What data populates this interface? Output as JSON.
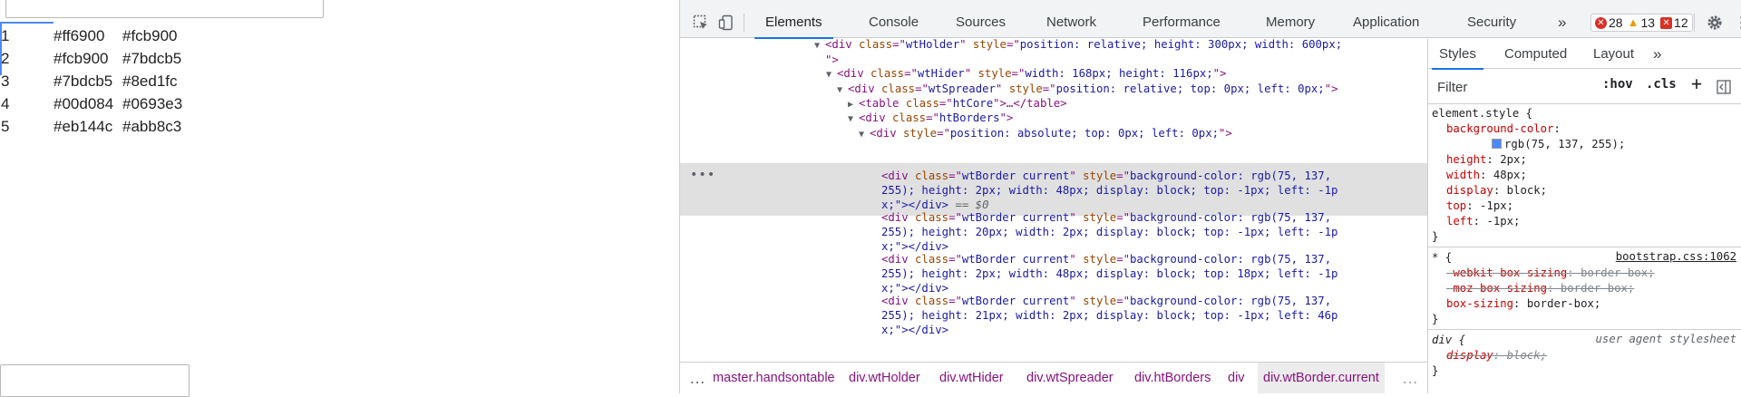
{
  "page": {
    "rows": [
      {
        "num": "1",
        "a": "#ff6900",
        "b": "#fcb900"
      },
      {
        "num": "2",
        "a": "#fcb900",
        "b": "#7bdcb5"
      },
      {
        "num": "3",
        "a": "#7bdcb5",
        "b": "#8ed1fc"
      },
      {
        "num": "4",
        "a": "#00d084",
        "b": "#0693e3"
      },
      {
        "num": "5",
        "a": "#eb144c",
        "b": "#abb8c3"
      }
    ],
    "selection_color": "#4b89ff"
  },
  "devtools": {
    "tabs": [
      "Elements",
      "Console",
      "Sources",
      "Network",
      "Performance",
      "Memory",
      "Application",
      "Security"
    ],
    "more_tabs": "»",
    "errors": "28",
    "warnings": "13",
    "issues": "12",
    "tree": {
      "l1": {
        "tag": "div",
        "cls": "wtHolder",
        "style": "position: relative; height: 300px; width: 600px;",
        "cont": "\">"
      },
      "l2": {
        "tag": "div",
        "cls": "wtHider",
        "style": "width: 168px; height: 116px;"
      },
      "l3": {
        "tag": "div",
        "cls": "wtSpreader",
        "style": "position: relative; top: 0px; left: 0px;"
      },
      "l4": {
        "tag": "table",
        "cls": "htCore",
        "tail": "…</table>"
      },
      "l5": {
        "tag": "div",
        "cls": "htBorders"
      },
      "l6": {
        "tag": "div",
        "style": "position: absolute; top: 0px; left: 0px;"
      },
      "borders": [
        {
          "a": "wtBorder current",
          "s1": "background-color: rgb(75, 137,",
          "s2": "255); height: 2px; width: 48px; display: block; top: -1px; left: -1p",
          "s3": "x;\"></div>",
          "eq": " == $0"
        },
        {
          "a": "wtBorder current",
          "s1": "background-color: rgb(75, 137,",
          "s2": "255); height: 20px; width: 2px; display: block; top: -1px; left: -1p",
          "s3": "x;\"></div>",
          "eq": ""
        },
        {
          "a": "wtBorder current",
          "s1": "background-color: rgb(75, 137,",
          "s2": "255); height: 2px; width: 48px; display: block; top: 18px; left: -1p",
          "s3": "x;\"></div>",
          "eq": ""
        },
        {
          "a": "wtBorder current",
          "s1": "background-color: rgb(75, 137,",
          "s2": "255); height: 21px; width: 2px; display: block; top: -1px; left: 46p",
          "s3": "x;\"></div>",
          "eq": ""
        }
      ]
    },
    "breadcrumbs": [
      "master.handsontable",
      "div.wtHolder",
      "div.wtHider",
      "div.wtSpreader",
      "div.htBorders",
      "div",
      "div.wtBorder.current"
    ],
    "breadcrumb_more": "…",
    "sidebar_tabs": [
      "Styles",
      "Computed",
      "Layout",
      "»"
    ],
    "filter_placeholder": "Filter",
    "hov": ":hov",
    "cls": ".cls",
    "plus": "+",
    "styles": {
      "element_selector": "element.style {",
      "swatch_color": "#4b89ff",
      "props": [
        {
          "name": "background-color",
          "value": "rgb(75, 137, 255);"
        },
        {
          "name": "height",
          "value": "2px;"
        },
        {
          "name": "width",
          "value": "48px;"
        },
        {
          "name": "display",
          "value": "block;"
        },
        {
          "name": "top",
          "value": "-1px;"
        },
        {
          "name": "left",
          "value": "-1px;"
        }
      ],
      "close": "}",
      "star_selector": "* {",
      "star_source": "bootstrap.css:1062",
      "star_props": [
        {
          "name": "-webkit-box-sizing",
          "value": "border-box;",
          "struck": true
        },
        {
          "name": "-moz-box-sizing",
          "value": "border-box;",
          "struck": true
        },
        {
          "name": "box-sizing",
          "value": "border-box;",
          "struck": false
        }
      ],
      "div_selector": "div {",
      "div_source": "user agent stylesheet",
      "div_props": [
        {
          "name": "display",
          "value": "block;",
          "struck": true
        }
      ]
    }
  }
}
